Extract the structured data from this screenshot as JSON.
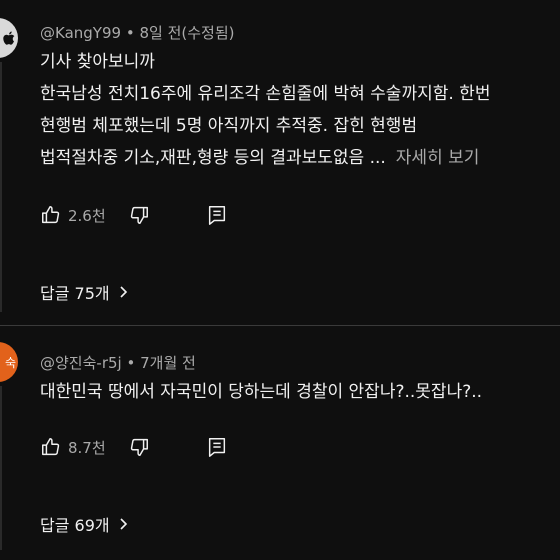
{
  "comments": [
    {
      "author": "@KangY99",
      "time": "8일 전(수정됨)",
      "lines": [
        "기사 찾아보니까",
        "한국남성 전치16주에 유리조각 손힘줄에 박혀 수술까지함. 한번",
        "현행범 체포했는데 5명 아직까지 추적중. 잡힌 현행범",
        "법적절차중 기소,재판,형량 등의 결과보도없음 ..."
      ],
      "more_label": "자세히 보기",
      "likes": "2.6천",
      "replies_label": "답글 75개"
    },
    {
      "author": "@양진숙-r5j",
      "time": "7개월 전",
      "avatar_text": "숙",
      "lines": [
        "대한민국 땅에서 자국민이 당하는데 경찰이 안잡나?..못잡나?.."
      ],
      "likes": "8.7천",
      "replies_label": "답글 69개"
    }
  ],
  "meta_separator": "•",
  "colors": {
    "background": "#0f0f0f",
    "text": "#f1f1f1",
    "muted": "#aaaaaa",
    "avatar2": "#e2621b"
  },
  "icons": [
    "apple-logo-icon",
    "thumb-up-icon",
    "thumb-down-icon",
    "reply-icon",
    "chevron-right-icon"
  ]
}
